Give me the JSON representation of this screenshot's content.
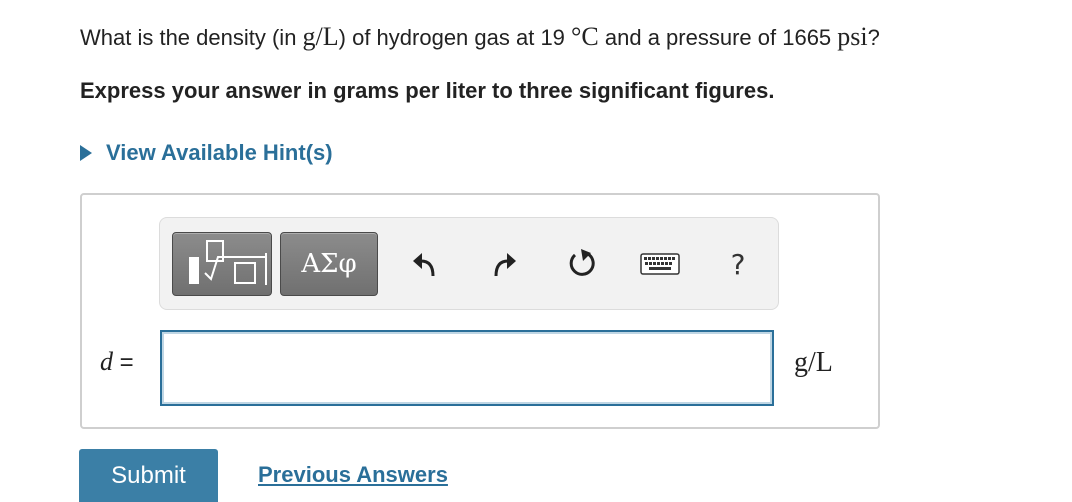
{
  "question": {
    "part1": "What is the density (in ",
    "unit_density": "g/L",
    "part2": ") of hydrogen gas at 19 ",
    "unit_temp": "°C",
    "part3": " and a pressure of 1665 ",
    "unit_pressure": "psi",
    "part4": "?"
  },
  "instruction": "Express your answer in grams per liter to three significant figures.",
  "hint": {
    "label": "View Available Hint(s)"
  },
  "toolbar": {
    "symbols_label": "ΑΣφ",
    "help_label": "?",
    "icons": [
      "templates-icon",
      "greek-symbols-icon",
      "undo-icon",
      "redo-icon",
      "reset-icon",
      "keyboard-icon",
      "help-icon"
    ]
  },
  "answer": {
    "variable": "d",
    "equals": " =",
    "value": "",
    "unit": "g/L"
  },
  "actions": {
    "submit_label": "Submit",
    "previous_answers_label": "Previous Answers"
  },
  "colors": {
    "accent": "#2a6f99",
    "submit_bg": "#3b7fa6",
    "toolbar_button": "#7a7a7a"
  }
}
